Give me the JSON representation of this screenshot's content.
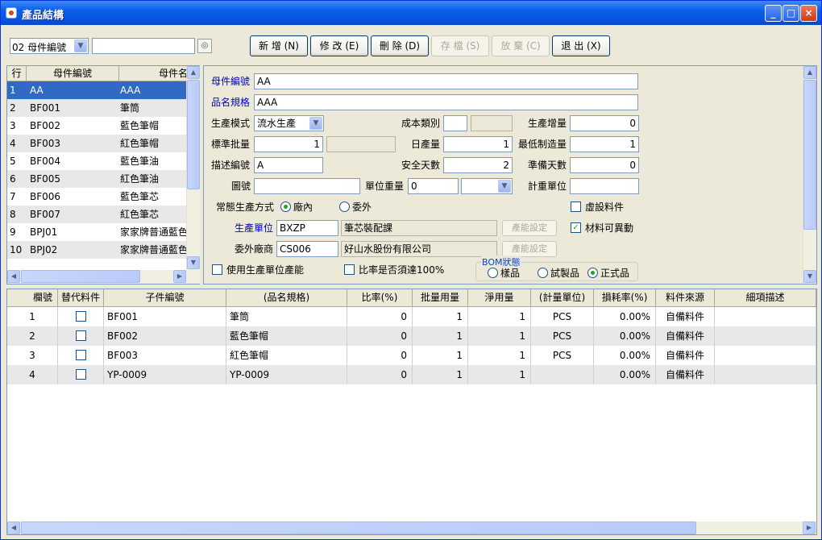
{
  "window": {
    "title": "產品結構",
    "minimize": "_",
    "maximize": "□",
    "close": "×"
  },
  "toolbar": {
    "search_field": "02 母件編號",
    "search_value": "",
    "buttons": [
      {
        "label": "新 增 (N)",
        "enabled": true
      },
      {
        "label": "修 改 (E)",
        "enabled": true
      },
      {
        "label": "刪 除 (D)",
        "enabled": true
      },
      {
        "label": "存 檔 (S)",
        "enabled": false
      },
      {
        "label": "放 棄 (C)",
        "enabled": false
      },
      {
        "label": "退 出 (X)",
        "enabled": true
      }
    ]
  },
  "parent_list": {
    "headers": [
      "行",
      "母件編號",
      "母件名"
    ],
    "rows": [
      {
        "line": "1",
        "code": "AA",
        "name": "AAA"
      },
      {
        "line": "2",
        "code": "BF001",
        "name": "筆筒"
      },
      {
        "line": "3",
        "code": "BF002",
        "name": "藍色筆帽"
      },
      {
        "line": "4",
        "code": "BF003",
        "name": "紅色筆帽"
      },
      {
        "line": "5",
        "code": "BF004",
        "name": "藍色筆油"
      },
      {
        "line": "6",
        "code": "BF005",
        "name": "紅色筆油"
      },
      {
        "line": "7",
        "code": "BF006",
        "name": "藍色筆芯"
      },
      {
        "line": "8",
        "code": "BF007",
        "name": "紅色筆芯"
      },
      {
        "line": "9",
        "code": "BPJ01",
        "name": "家家牌普通藍色"
      },
      {
        "line": "10",
        "code": "BPJ02",
        "name": "家家牌普通藍色"
      }
    ],
    "selected_index": 0
  },
  "form": {
    "parent_code_label": "母件編號",
    "parent_code": "AA",
    "spec_label": "品名規格",
    "spec": "AAA",
    "mode_label": "生產模式",
    "mode": "流水生產",
    "cost_type_label": "成本類別",
    "cost_type": "",
    "cost_type_desc": "",
    "increment_label": "生產增量",
    "increment": "0",
    "std_batch_label": "標準批量",
    "std_batch": "1",
    "std_batch_extra": "",
    "daily_label": "日產量",
    "daily": "1",
    "min_label": "最低制造量",
    "min": "1",
    "desc_code_label": "描述編號",
    "desc_code": "A",
    "safety_label": "安全天數",
    "safety": "2",
    "prep_label": "準備天數",
    "prep": "0",
    "drawing_label": "圖號",
    "drawing": "",
    "unit_weight_label": "單位重量",
    "unit_weight": "0",
    "weight_unit": "",
    "measure_unit_label": "計重單位",
    "measure_unit": "",
    "virtual_label": "虛設料件",
    "method_label": "常態生產方式",
    "method_in": "廠內",
    "method_out": "委外",
    "material_change_label": "材料可異動",
    "prod_unit_label": "生產單位",
    "prod_unit": "BXZP",
    "prod_unit_name": "筆芯裝配課",
    "capacity_btn": "產能設定",
    "outsource_label": "委外廠商",
    "outsource": "CS006",
    "outsource_name": "好山水股份有限公司",
    "capacity_btn2": "產能設定",
    "use_capacity_label": "使用生產單位產能",
    "ratio_label": "比率是否須達100%",
    "bom_legend": "BOM狀態",
    "bom_sample": "樣品",
    "bom_trial": "試製品",
    "bom_formal": "正式品"
  },
  "components": {
    "headers": [
      "欄號",
      "替代料件",
      "子件編號",
      "(品名規格)",
      "比率(%)",
      "批量用量",
      "淨用量",
      "(計量單位)",
      "損耗率(%)",
      "料件來源",
      "細項描述"
    ],
    "rows": [
      {
        "no": "1",
        "code": "BF001",
        "spec": "筆筒",
        "ratio": "0",
        "batch": "1",
        "net": "1",
        "unit": "PCS",
        "loss": "0.00%",
        "source": "自備料件"
      },
      {
        "no": "2",
        "code": "BF002",
        "spec": "藍色筆帽",
        "ratio": "0",
        "batch": "1",
        "net": "1",
        "unit": "PCS",
        "loss": "0.00%",
        "source": "自備料件"
      },
      {
        "no": "3",
        "code": "BF003",
        "spec": "紅色筆帽",
        "ratio": "0",
        "batch": "1",
        "net": "1",
        "unit": "PCS",
        "loss": "0.00%",
        "source": "自備料件"
      },
      {
        "no": "4",
        "code": "YP-0009",
        "spec": "YP-0009",
        "ratio": "0",
        "batch": "1",
        "net": "1",
        "unit": "",
        "loss": "0.00%",
        "source": "自備料件"
      }
    ]
  }
}
